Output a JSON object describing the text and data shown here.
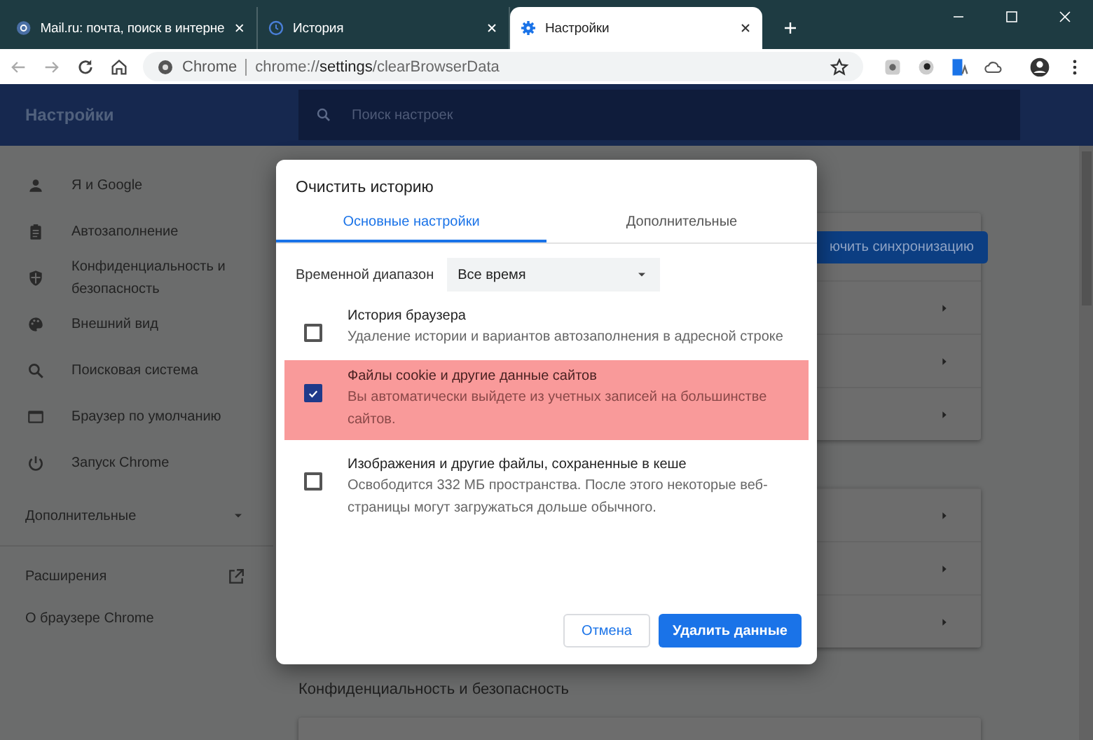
{
  "browser_tabs": [
    {
      "title": "Mail.ru: почта, поиск в интерне",
      "selected": false
    },
    {
      "title": "История",
      "selected": false
    },
    {
      "title": "Настройки",
      "selected": true
    }
  ],
  "address_bar": {
    "chip": "Chrome",
    "url": "chrome://**settings**/clearBrowserData"
  },
  "settings_header": {
    "title": "Настройки",
    "search_placeholder": "Поиск настроек"
  },
  "sidebar": {
    "items": [
      {
        "label": "Я и Google"
      },
      {
        "label": "Автозаполнение"
      },
      {
        "label": "Конфиденциальность и безопасность"
      },
      {
        "label": "Внешний вид"
      },
      {
        "label": "Поисковая система"
      },
      {
        "label": "Браузер по умолчанию"
      },
      {
        "label": "Запуск Chrome"
      }
    ],
    "advanced": {
      "label": "Дополнительные",
      "expanded": false
    },
    "extensions": "Расширения",
    "about": "О браузере Chrome"
  },
  "background": {
    "sync_button": "ючить синхронизацию",
    "section_heading": "Конфиденциальность и безопасность"
  },
  "dialog": {
    "title": "Очистить историю",
    "tabs": [
      {
        "label": "Основные настройки",
        "selected": true
      },
      {
        "label": "Дополнительные",
        "selected": false
      }
    ],
    "time_range": {
      "label": "Временной диапазон",
      "value": "Все время"
    },
    "options": [
      {
        "title": "История браузера",
        "description": "Удаление истории и вариантов автозаполнения в адресной строке",
        "checked": false,
        "highlighted": false
      },
      {
        "title": "Файлы cookie и другие данные сайтов",
        "description": "Вы автоматически выйдете из учетных записей на большинстве сайтов.",
        "checked": true,
        "highlighted": true
      },
      {
        "title": "Изображения и другие файлы, сохраненные в кеше",
        "description": "Освободится 332 МБ пространства. После этого некоторые веб-страницы могут загружаться дольше обычного.",
        "checked": false,
        "highlighted": false
      }
    ],
    "cancel_button": "Отмена",
    "confirm_button": "Удалить данные"
  }
}
